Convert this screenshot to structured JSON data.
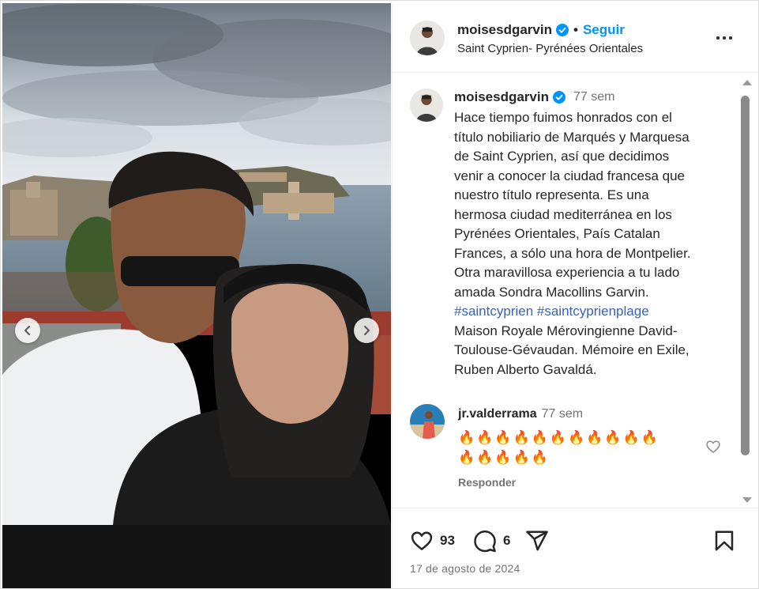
{
  "post": {
    "username": "moisesdgarvin",
    "follow_label": "Seguir",
    "separator": "•",
    "location": "Saint Cyprien- Pyrénées Orientales",
    "caption_time": "77 sem",
    "caption_lines": [
      "Hace tiempo fuimos honrados con el",
      "título nobiliario de Marqués y Marquesa",
      "de Saint Cyprien, así que decidimos",
      "venir a conocer la ciudad francesa que",
      "nuestro título representa. Es una",
      "hermosa ciudad mediterránea en los",
      "Pyrénées Orientales, País Catalan",
      "Frances, a sólo una hora de Montpelier.",
      "Otra maravillosa experiencia a tu lado",
      "amada Sondra Macollins Garvin."
    ],
    "hashtags": "#saintcyprien #saintcyprienplage",
    "caption_tail_lines": [
      "Maison Royale Mérovingienne David-",
      "Toulouse-Gévaudan. Mémoire en Exile,",
      "Ruben Alberto Gavaldá."
    ]
  },
  "comment": {
    "username": "jr.valderrama",
    "time": "77 sem",
    "emoji_line_1": "🔥🔥🔥🔥🔥🔥🔥🔥🔥🔥🔥",
    "emoji_line_2": "🔥🔥🔥🔥🔥",
    "reply_label": "Responder"
  },
  "actions": {
    "likes": "93",
    "comments": "6",
    "date": "17 de agosto de 2024"
  },
  "icons": {
    "verified": "verified-badge-icon",
    "more": "more-options-icon",
    "like": "heart-icon",
    "comment": "comment-bubble-icon",
    "share": "paper-plane-icon",
    "save": "bookmark-icon",
    "prev": "chevron-left-icon",
    "next": "chevron-right-icon"
  },
  "colors": {
    "accent": "#0095f6",
    "hashtag": "#3a62b5",
    "verified": "#0095f6",
    "muted": "#737373"
  }
}
